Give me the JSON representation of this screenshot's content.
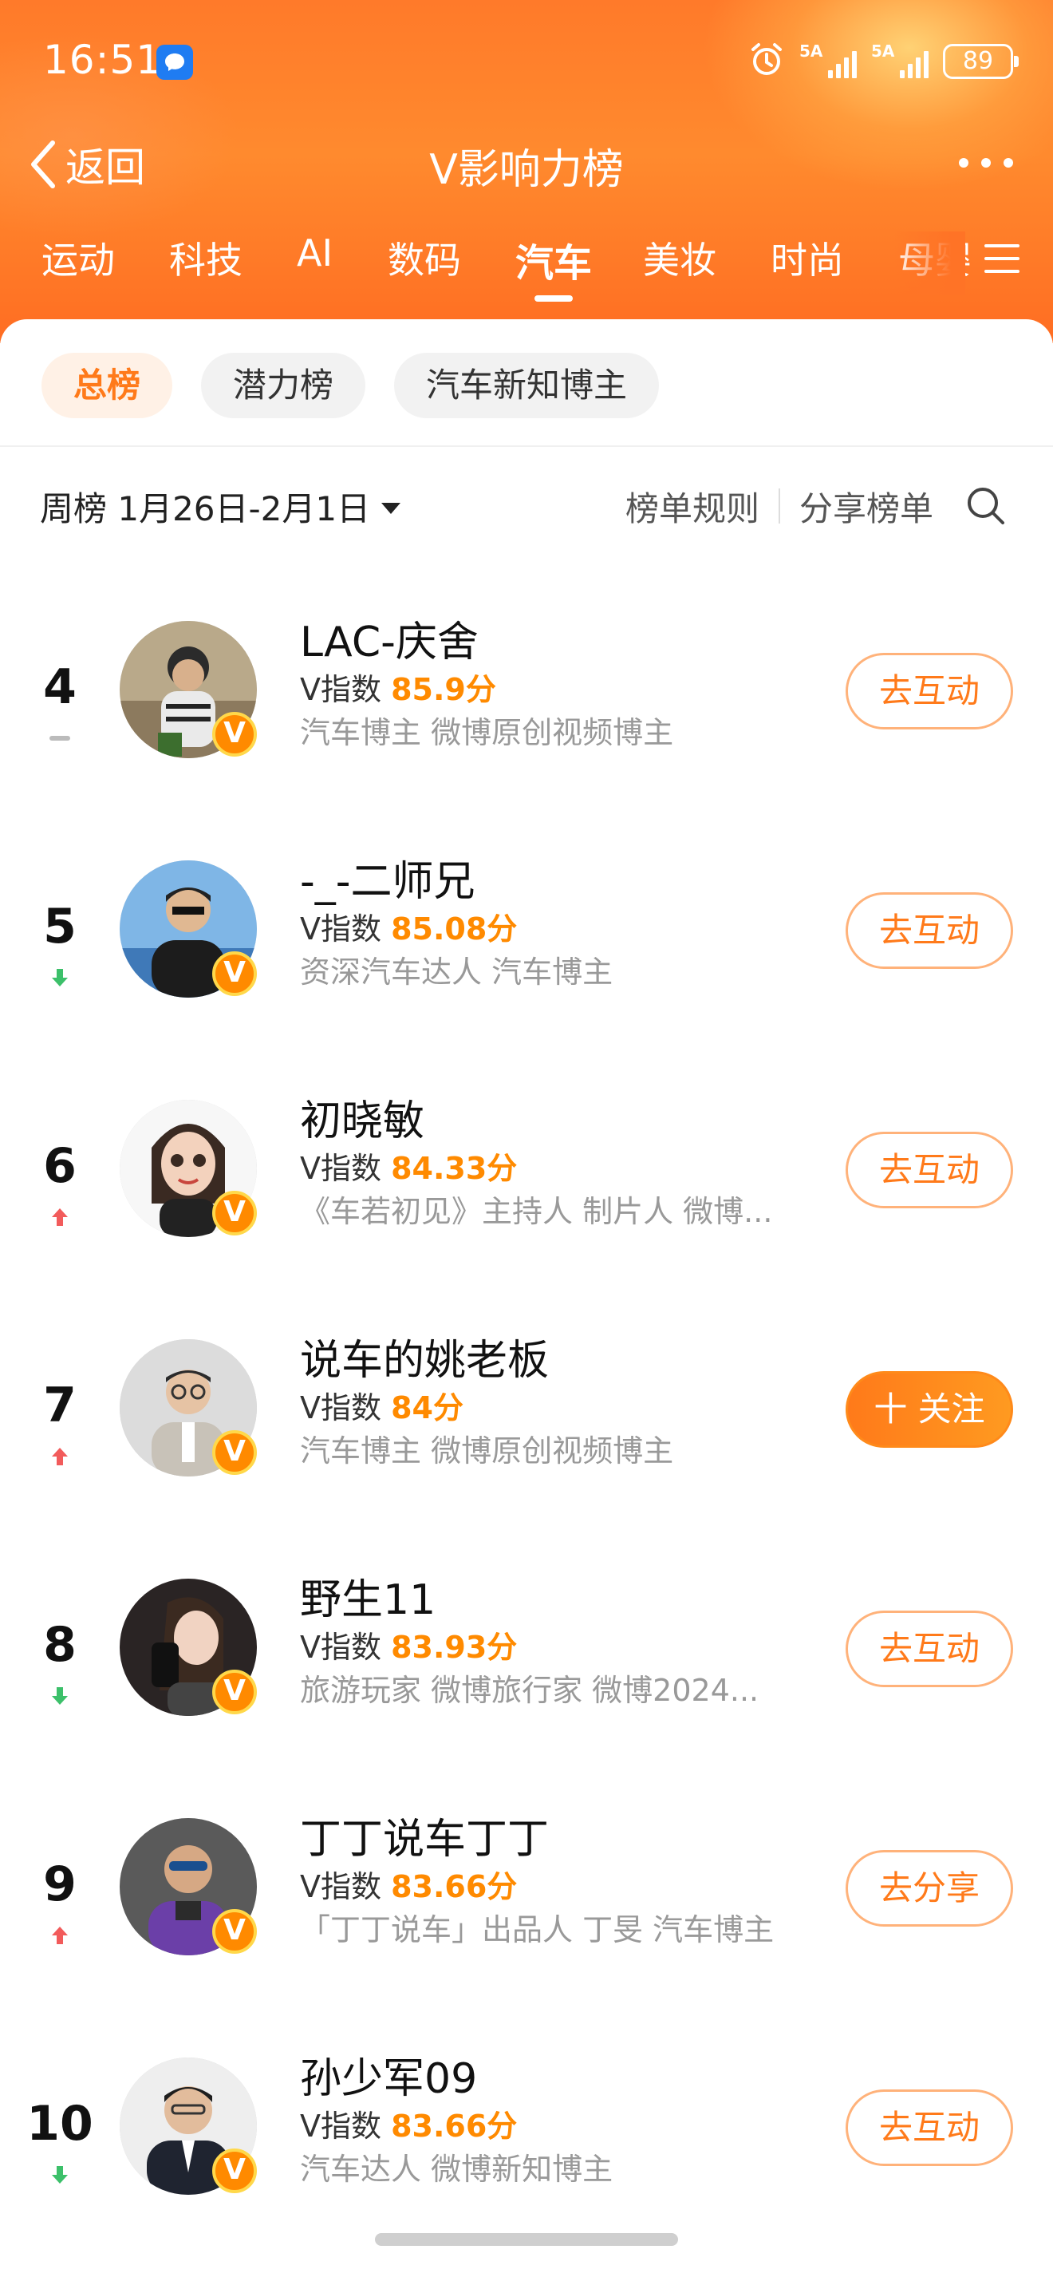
{
  "status_bar": {
    "time": "16:51",
    "network1": "5A",
    "network2": "5A",
    "battery": "89"
  },
  "nav": {
    "back_label": "返回",
    "title": "V影响力榜"
  },
  "tabs": [
    {
      "label": "运动"
    },
    {
      "label": "科技"
    },
    {
      "label": "AI"
    },
    {
      "label": "数码"
    },
    {
      "label": "汽车",
      "active": true
    },
    {
      "label": "美妆"
    },
    {
      "label": "时尚"
    },
    {
      "label": "母婴"
    }
  ],
  "subtabs": [
    {
      "label": "总榜",
      "active": true
    },
    {
      "label": "潜力榜"
    },
    {
      "label": "汽车新知博主"
    }
  ],
  "filter": {
    "period": "周榜 1月26日-2月1日",
    "rules": "榜单规则",
    "share": "分享榜单"
  },
  "rows": [
    {
      "rank": "4",
      "trend": "same",
      "name": "LAC-庆舍",
      "vidx_label": "V指数",
      "score": "85.9分",
      "desc": "汽车博主 微博原创视频博主",
      "button": "去互动"
    },
    {
      "rank": "5",
      "trend": "down",
      "name": "-_-二师兄",
      "vidx_label": "V指数",
      "score": "85.08分",
      "desc": "资深汽车达人 汽车博主",
      "button": "去互动"
    },
    {
      "rank": "6",
      "trend": "up",
      "name": "初晓敏",
      "vidx_label": "V指数",
      "score": "84.33分",
      "desc": "《车若初见》主持人 制片人 微博...",
      "button": "去互动"
    },
    {
      "rank": "7",
      "trend": "up",
      "name": "说车的姚老板",
      "vidx_label": "V指数",
      "score": "84分",
      "desc": "汽车博主 微博原创视频博主",
      "button": "十 关注",
      "primary": true
    },
    {
      "rank": "8",
      "trend": "down",
      "name": "野生11",
      "vidx_label": "V指数",
      "score": "83.93分",
      "desc": "旅游玩家 微博旅行家 微博2024...",
      "button": "去互动"
    },
    {
      "rank": "9",
      "trend": "up",
      "name": "丁丁说车丁丁",
      "vidx_label": "V指数",
      "score": "83.66分",
      "desc": "「丁丁说车」出品人 丁旻 汽车博主",
      "button": "去分享"
    },
    {
      "rank": "10",
      "trend": "down",
      "name": "孙少军09",
      "vidx_label": "V指数",
      "score": "83.66分",
      "desc": "汽车达人 微博新知博主",
      "button": "去互动"
    }
  ],
  "badge_label": "V",
  "colors": {
    "accent": "#ff7a1a",
    "score": "#ff8a00",
    "up": "#f25b5b",
    "down": "#3cc06a"
  }
}
